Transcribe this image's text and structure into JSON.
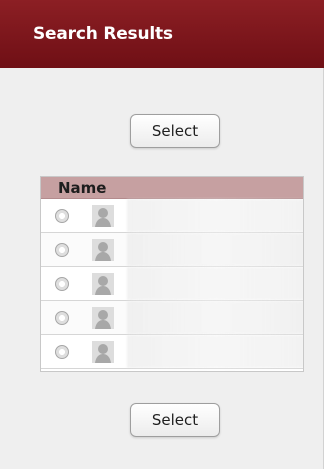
{
  "header": {
    "title": "Search Results"
  },
  "actions": {
    "select_label": "Select"
  },
  "results": {
    "column_header": "Name",
    "rows": [
      {
        "name": ""
      },
      {
        "name": ""
      },
      {
        "name": ""
      },
      {
        "name": ""
      },
      {
        "name": ""
      }
    ]
  },
  "icons": {
    "avatar": "person-placeholder-icon",
    "radio": "radio-button"
  },
  "colors": {
    "header_bg": "#7b141b",
    "table_header_bg": "#c6a0a1"
  }
}
